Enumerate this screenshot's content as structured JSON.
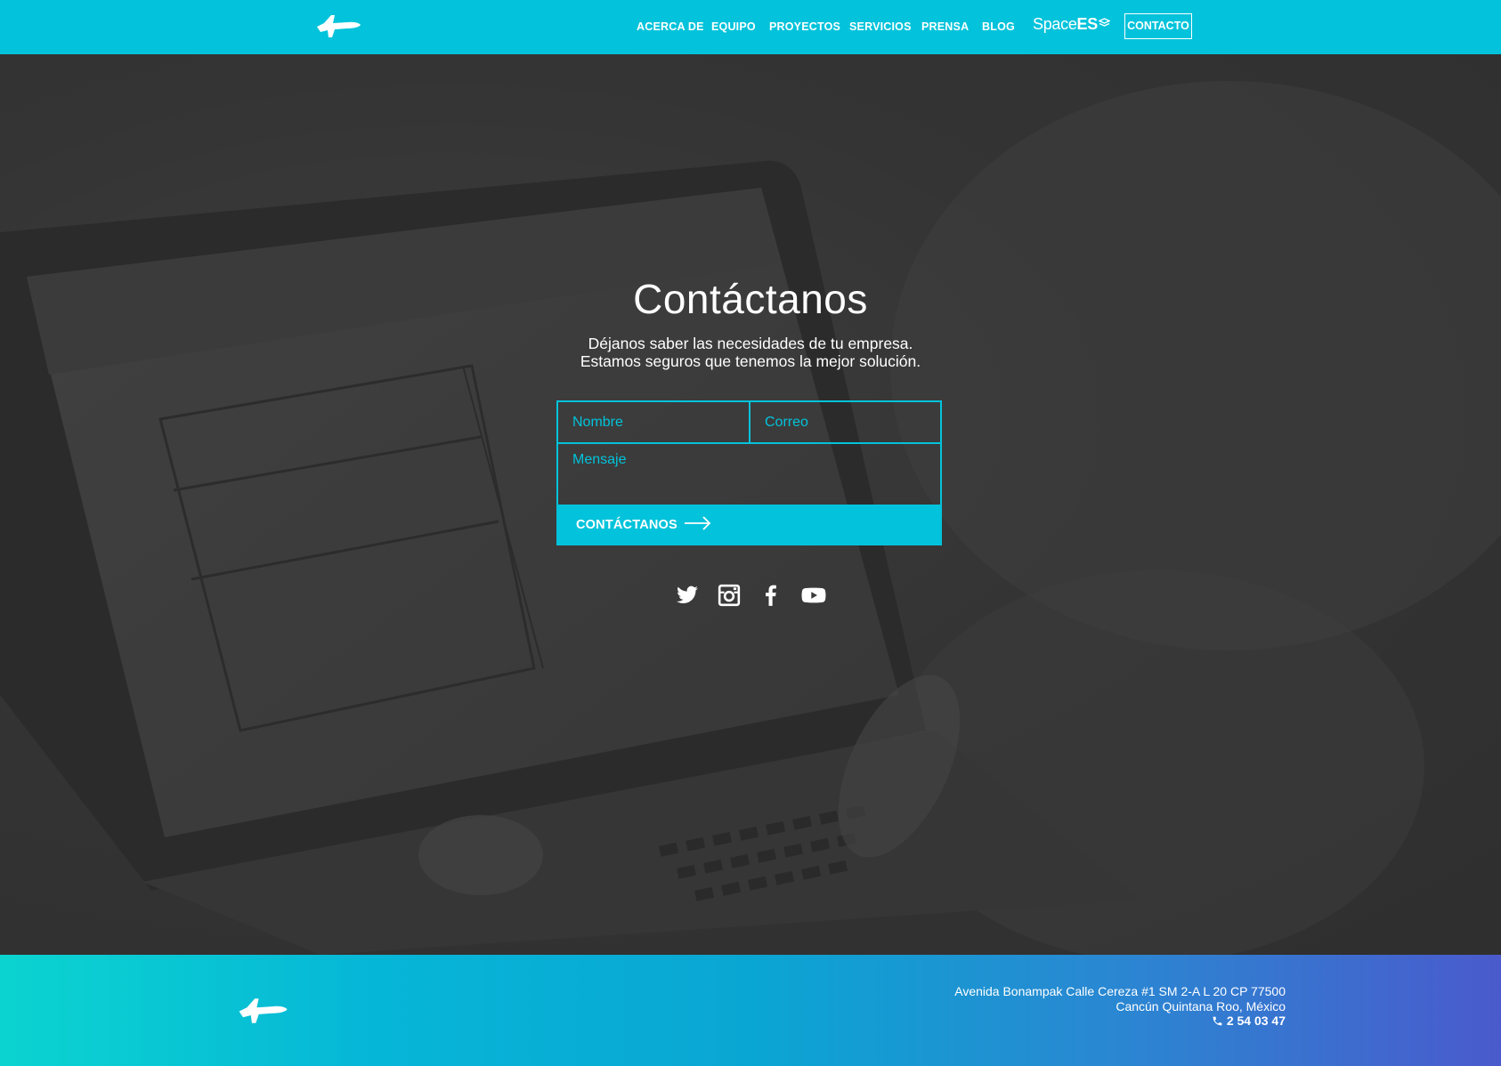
{
  "brand": {
    "logo_icon": "spaceship-icon",
    "primary_color": "#02c3db",
    "spacees_prefix": "Space",
    "spacees_bold": "ES"
  },
  "nav": {
    "items": [
      {
        "label": "ACERCA DE"
      },
      {
        "label": "EQUIPO"
      },
      {
        "label": "PROYECTOS"
      },
      {
        "label": "SERVICIOS"
      },
      {
        "label": "PRENSA"
      },
      {
        "label": "BLOG"
      }
    ],
    "contact_label": "CONTACTO"
  },
  "hero": {
    "title": "Contáctanos",
    "subtitle_line1": "Déjanos saber las necesidades de tu empresa.",
    "subtitle_line2": "Estamos seguros que tenemos la mejor solución."
  },
  "form": {
    "name_placeholder": "Nombre",
    "email_placeholder": "Correo",
    "message_placeholder": "Mensaje",
    "submit_label": "CONTÁCTANOS",
    "submit_icon": "arrow-right-icon"
  },
  "socials": [
    {
      "icon": "twitter-icon"
    },
    {
      "icon": "instagram-icon"
    },
    {
      "icon": "facebook-icon"
    },
    {
      "icon": "youtube-icon"
    }
  ],
  "footer": {
    "address_line1": "Avenida Bonampak Calle Cereza #1 SM 2-A L 20 CP 77500",
    "address_line2": "Cancún Quintana Roo, México",
    "phone": "2 54 03 47",
    "phone_icon": "phone-icon"
  }
}
